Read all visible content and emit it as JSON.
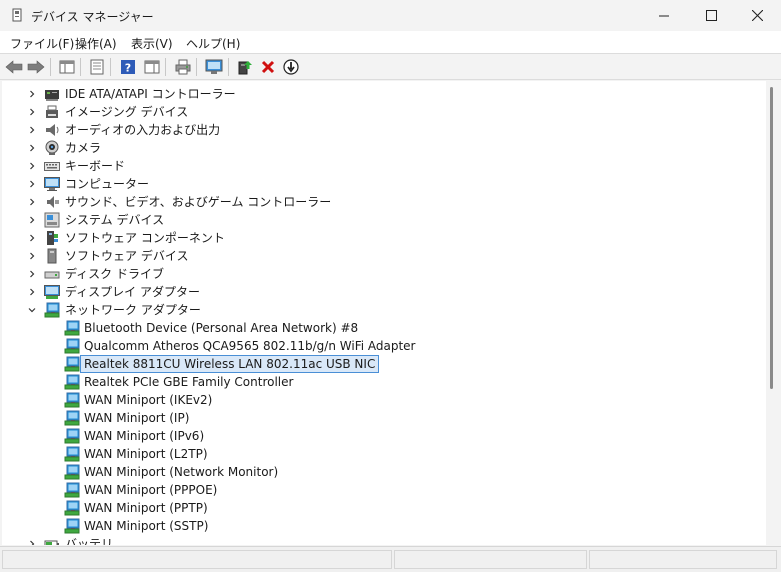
{
  "window": {
    "title": "デバイス マネージャー"
  },
  "menu": [
    {
      "label": "ファイル(F)"
    },
    {
      "label": "操作(A)"
    },
    {
      "label": "表示(V)"
    },
    {
      "label": "ヘルプ(H)"
    }
  ],
  "tree": {
    "rows": [
      {
        "label": "IDE ATA/ATAPI コントローラー",
        "icon": "ide-controller-icon",
        "state": "collapsed"
      },
      {
        "label": "イメージング デバイス",
        "icon": "imaging-device-icon",
        "state": "collapsed"
      },
      {
        "label": "オーディオの入力および出力",
        "icon": "speaker-icon",
        "state": "collapsed"
      },
      {
        "label": "カメラ",
        "icon": "camera-icon",
        "state": "collapsed"
      },
      {
        "label": "キーボード",
        "icon": "keyboard-icon",
        "state": "collapsed"
      },
      {
        "label": "コンピューター",
        "icon": "computer-icon",
        "state": "collapsed"
      },
      {
        "label": "サウンド、ビデオ、およびゲーム コントローラー",
        "icon": "sound-icon",
        "state": "collapsed"
      },
      {
        "label": "システム デバイス",
        "icon": "system-device-icon",
        "state": "collapsed"
      },
      {
        "label": "ソフトウェア コンポーネント",
        "icon": "software-component-icon",
        "state": "collapsed"
      },
      {
        "label": "ソフトウェア デバイス",
        "icon": "software-device-icon",
        "state": "collapsed"
      },
      {
        "label": "ディスク ドライブ",
        "icon": "disk-drive-icon",
        "state": "collapsed"
      },
      {
        "label": "ディスプレイ アダプター",
        "icon": "display-adapter-icon",
        "state": "collapsed"
      },
      {
        "label": "ネットワーク アダプター",
        "icon": "network-adapter-icon",
        "state": "expanded"
      },
      {
        "label": "Bluetooth Device (Personal Area Network) #8",
        "icon": "network-adapter-icon",
        "state": "child"
      },
      {
        "label": "Qualcomm Atheros QCA9565 802.11b/g/n WiFi Adapter",
        "icon": "network-adapter-icon",
        "state": "child"
      },
      {
        "label": "Realtek 8811CU Wireless LAN 802.11ac USB NIC",
        "icon": "network-adapter-icon",
        "state": "child-selected"
      },
      {
        "label": "Realtek PCIe GBE Family Controller",
        "icon": "network-adapter-icon",
        "state": "child"
      },
      {
        "label": "WAN Miniport (IKEv2)",
        "icon": "network-adapter-icon",
        "state": "child"
      },
      {
        "label": "WAN Miniport (IP)",
        "icon": "network-adapter-icon",
        "state": "child"
      },
      {
        "label": "WAN Miniport (IPv6)",
        "icon": "network-adapter-icon",
        "state": "child"
      },
      {
        "label": "WAN Miniport (L2TP)",
        "icon": "network-adapter-icon",
        "state": "child"
      },
      {
        "label": "WAN Miniport (Network Monitor)",
        "icon": "network-adapter-icon",
        "state": "child"
      },
      {
        "label": "WAN Miniport (PPPOE)",
        "icon": "network-adapter-icon",
        "state": "child"
      },
      {
        "label": "WAN Miniport (PPTP)",
        "icon": "network-adapter-icon",
        "state": "child"
      },
      {
        "label": "WAN Miniport (SSTP)",
        "icon": "network-adapter-icon",
        "state": "child"
      },
      {
        "label": "バッテリ",
        "icon": "battery-icon",
        "state": "collapsed"
      }
    ]
  },
  "colors": {
    "selection_bg": "#d9e8f8",
    "selection_border": "#4a8fd6",
    "network_icon": "#1e8fd8",
    "delete_icon": "#d01010"
  }
}
